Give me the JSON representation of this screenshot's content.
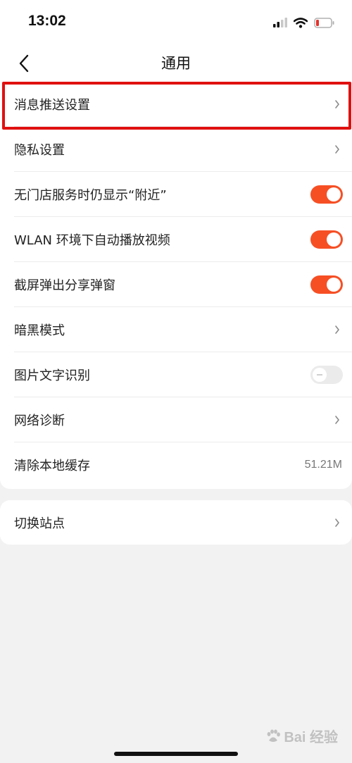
{
  "status_bar": {
    "time": "13:02",
    "icons": [
      "cellular-signal-icon",
      "wifi-icon",
      "battery-low-icon"
    ]
  },
  "nav": {
    "title": "通用",
    "back_icon": "chevron-left-icon"
  },
  "settings": {
    "push": {
      "label": "消息推送设置",
      "type": "link"
    },
    "privacy": {
      "label": "隐私设置",
      "type": "link"
    },
    "nearby": {
      "label": "无门店服务时仍显示“附近”",
      "type": "toggle",
      "on": true
    },
    "wlan_autoplay": {
      "label": "WLAN 环境下自动播放视频",
      "type": "toggle",
      "on": true
    },
    "screenshot_share": {
      "label": "截屏弹出分享弹窗",
      "type": "toggle",
      "on": true
    },
    "dark_mode": {
      "label": "暗黑模式",
      "type": "link"
    },
    "ocr": {
      "label": "图片文字识别",
      "type": "toggle",
      "on": false
    },
    "network_diagnosis": {
      "label": "网络诊断",
      "type": "link"
    },
    "clear_cache": {
      "label": "清除本地缓存",
      "value": "51.21M"
    },
    "switch_site": {
      "label": "切换站点",
      "type": "link"
    }
  },
  "colors": {
    "toggle_on": "#f64f24",
    "toggle_off": "#ebebeb",
    "highlight": "#e01010",
    "background": "#f2f2f2"
  },
  "watermark": {
    "text": "Bai 经验"
  }
}
